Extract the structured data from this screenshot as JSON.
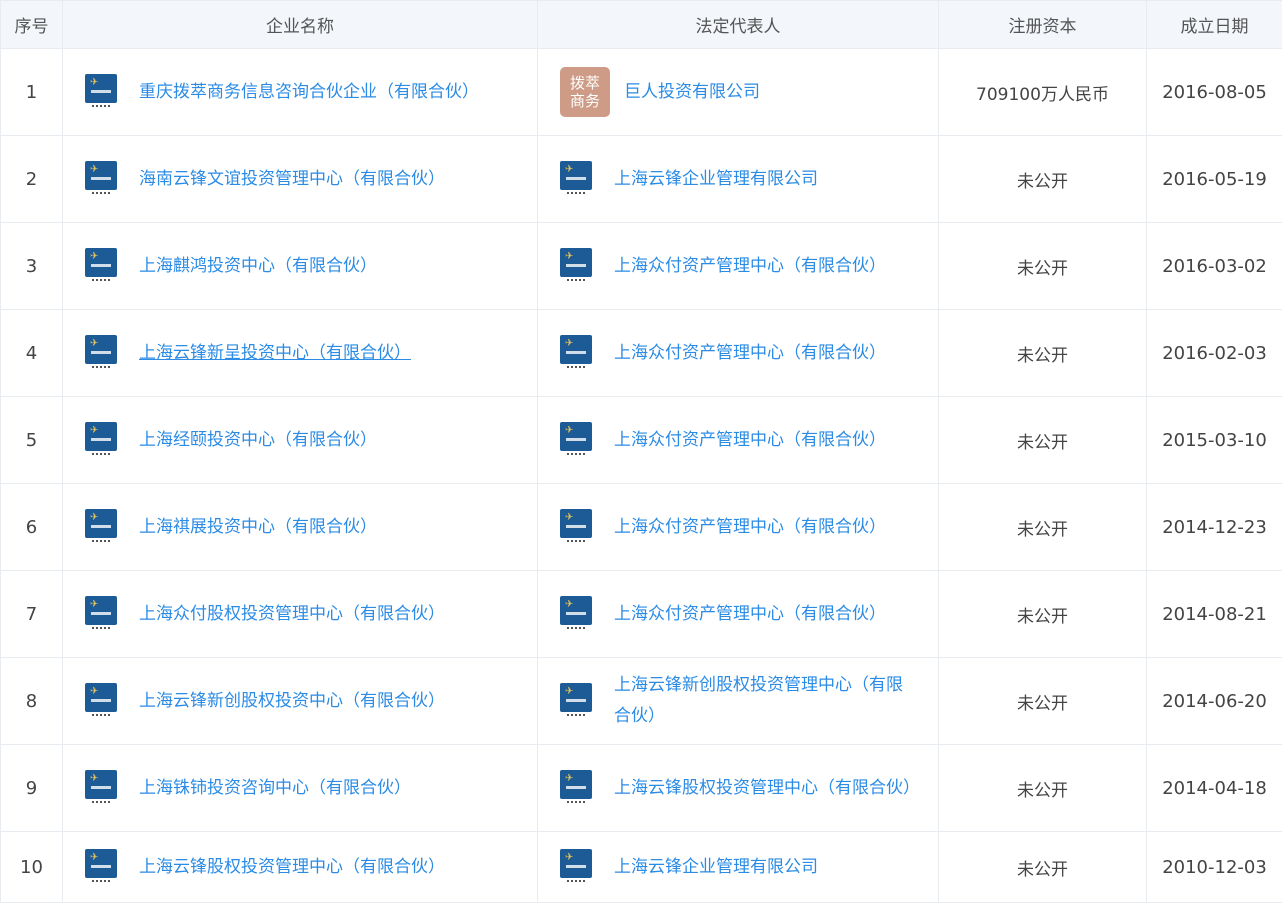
{
  "table": {
    "headers": [
      "序号",
      "企业名称",
      "法定代表人",
      "注册资本",
      "成立日期"
    ],
    "rows": [
      {
        "index": "1",
        "company": "重庆拨萃商务信息咨询合伙企业（有限合伙）",
        "rep_badge": "拨萃商务",
        "representative": "巨人投资有限公司",
        "capital": "709100万人民币",
        "date": "2016-08-05"
      },
      {
        "index": "2",
        "company": "海南云锋文谊投资管理中心（有限合伙）",
        "representative": "上海云锋企业管理有限公司",
        "capital": "未公开",
        "date": "2016-05-19"
      },
      {
        "index": "3",
        "company": "上海麒鸿投资中心（有限合伙）",
        "representative": "上海众付资产管理中心（有限合伙）",
        "capital": "未公开",
        "date": "2016-03-02"
      },
      {
        "index": "4",
        "company": "上海云锋新呈投资中心（有限合伙）",
        "representative": "上海众付资产管理中心（有限合伙）",
        "capital": "未公开",
        "date": "2016-02-03"
      },
      {
        "index": "5",
        "company": "上海经颐投资中心（有限合伙）",
        "representative": "上海众付资产管理中心（有限合伙）",
        "capital": "未公开",
        "date": "2015-03-10"
      },
      {
        "index": "6",
        "company": "上海祺展投资中心（有限合伙）",
        "representative": "上海众付资产管理中心（有限合伙）",
        "capital": "未公开",
        "date": "2014-12-23"
      },
      {
        "index": "7",
        "company": "上海众付股权投资管理中心（有限合伙）",
        "representative": "上海众付资产管理中心（有限合伙）",
        "capital": "未公开",
        "date": "2014-08-21"
      },
      {
        "index": "8",
        "company": "上海云锋新创股权投资中心（有限合伙）",
        "representative": "上海云锋新创股权投资管理中心（有限合伙）",
        "capital": "未公开",
        "date": "2014-06-20"
      },
      {
        "index": "9",
        "company": "上海铢铈投资咨询中心（有限合伙）",
        "representative": "上海云锋股权投资管理中心（有限合伙）",
        "capital": "未公开",
        "date": "2014-04-18"
      },
      {
        "index": "10",
        "company": "上海云锋股权投资管理中心（有限合伙）",
        "representative": "上海云锋企业管理有限公司",
        "capital": "未公开",
        "date": "2010-12-03"
      }
    ]
  },
  "colors": {
    "link": "#2b8be5",
    "header_bg": "#f3f6fb",
    "logo_bg": "#1c5b95",
    "badge_bg": "#cd9b86"
  },
  "icons": {
    "company_logo": "company-logo-icon"
  }
}
